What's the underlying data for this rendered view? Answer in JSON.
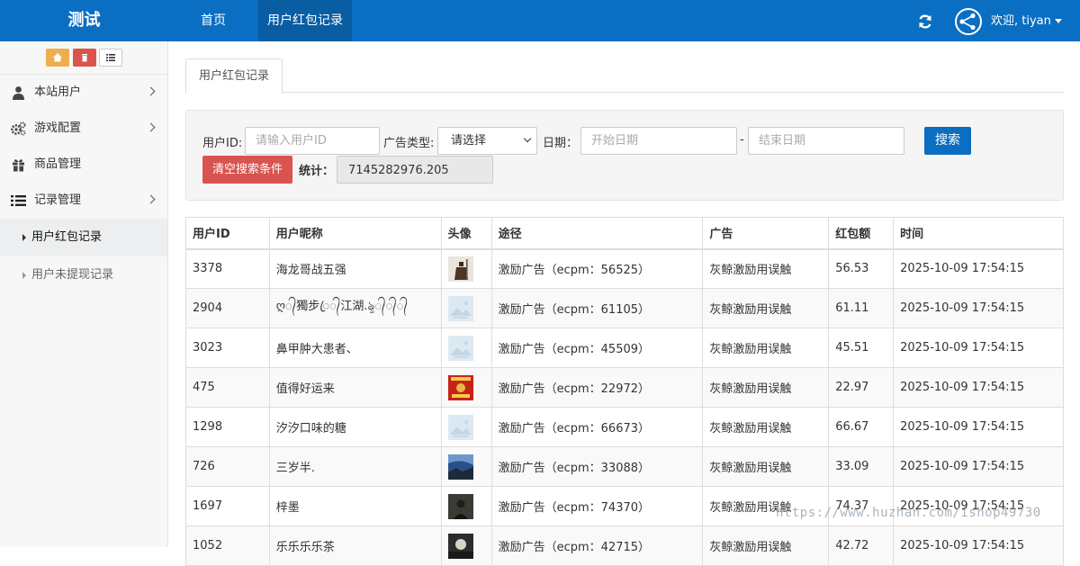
{
  "header": {
    "brand": "测试",
    "nav": [
      {
        "label": "首页",
        "active": false
      },
      {
        "label": "用户红包记录",
        "active": true
      }
    ],
    "welcome": "欢迎, tiyan"
  },
  "sidebar": {
    "menu": [
      {
        "label": "本站用户",
        "icon": "user-icon",
        "has_children": true
      },
      {
        "label": "游戏配置",
        "icon": "gears-icon",
        "has_children": true
      },
      {
        "label": "商品管理",
        "icon": "gift-icon",
        "has_children": false
      },
      {
        "label": "记录管理",
        "icon": "list-icon",
        "has_children": true
      }
    ],
    "submenu": [
      {
        "label": "用户红包记录",
        "active": true
      },
      {
        "label": "用户未提现记录",
        "active": false
      }
    ]
  },
  "tab": {
    "label": "用户红包记录"
  },
  "search": {
    "user_id_label": "用户ID:",
    "user_id_placeholder": "请输入用户ID",
    "ad_type_label": "广告类型:",
    "ad_type_value": "请选择",
    "date_label": "日期：",
    "start_placeholder": "开始日期",
    "date_sep": "-",
    "end_placeholder": "结束日期",
    "search_button": "搜索",
    "clear_button": "清空搜索条件",
    "total_label": "统计：",
    "total_value": "7145282976.205"
  },
  "table": {
    "headers": [
      "用户ID",
      "用户昵称",
      "头像",
      "途径",
      "广告",
      "红包额",
      "时间"
    ],
    "rows": [
      {
        "id": "3378",
        "nick": "海龙哥战五强",
        "avatar": "warrior",
        "path": "激励广告（ecpm：56525）",
        "ad": "灰鲸激励用误触",
        "amount": "56.53",
        "time": "2025-10-09 17:54:15"
      },
      {
        "id": "2904",
        "nick": "ღ᭄獨步ꦿ᭄江湖.ৡ᭄᭄᭄",
        "avatar": "placeholder",
        "path": "激励广告（ecpm：61105）",
        "ad": "灰鲸激励用误触",
        "amount": "61.11",
        "time": "2025-10-09 17:54:15"
      },
      {
        "id": "3023",
        "nick": "鼻甲肿大患者、",
        "avatar": "placeholder",
        "path": "激励广告（ecpm：45509）",
        "ad": "灰鲸激励用误触",
        "amount": "45.51",
        "time": "2025-10-09 17:54:15"
      },
      {
        "id": "475",
        "nick": "值得好运来",
        "avatar": "red-card",
        "path": "激励广告（ecpm：22972）",
        "ad": "灰鲸激励用误触",
        "amount": "22.97",
        "time": "2025-10-09 17:54:15"
      },
      {
        "id": "1298",
        "nick": "汐汐口味的糖",
        "avatar": "placeholder",
        "path": "激励广告（ecpm：66673）",
        "ad": "灰鲸激励用误触",
        "amount": "66.67",
        "time": "2025-10-09 17:54:15"
      },
      {
        "id": "726",
        "nick": "三岁半.",
        "avatar": "sky",
        "path": "激励广告（ecpm：33088）",
        "ad": "灰鲸激励用误触",
        "amount": "33.09",
        "time": "2025-10-09 17:54:15"
      },
      {
        "id": "1697",
        "nick": "梓墨",
        "avatar": "dark",
        "path": "激励广告（ecpm：74370）",
        "ad": "灰鲸激励用误触",
        "amount": "74.37",
        "time": "2025-10-09 17:54:15"
      },
      {
        "id": "1052",
        "nick": "乐乐乐乐茶",
        "avatar": "dark2",
        "path": "激励广告（ecpm：42715）",
        "ad": "灰鲸激励用误触",
        "amount": "42.72",
        "time": "2025-10-09 17:54:15"
      }
    ]
  },
  "watermark": "https://www.huzhan.com/ishop49730",
  "colors": {
    "primary": "#0a6fc2",
    "danger": "#d9534f",
    "warning": "#f0ad4e"
  }
}
